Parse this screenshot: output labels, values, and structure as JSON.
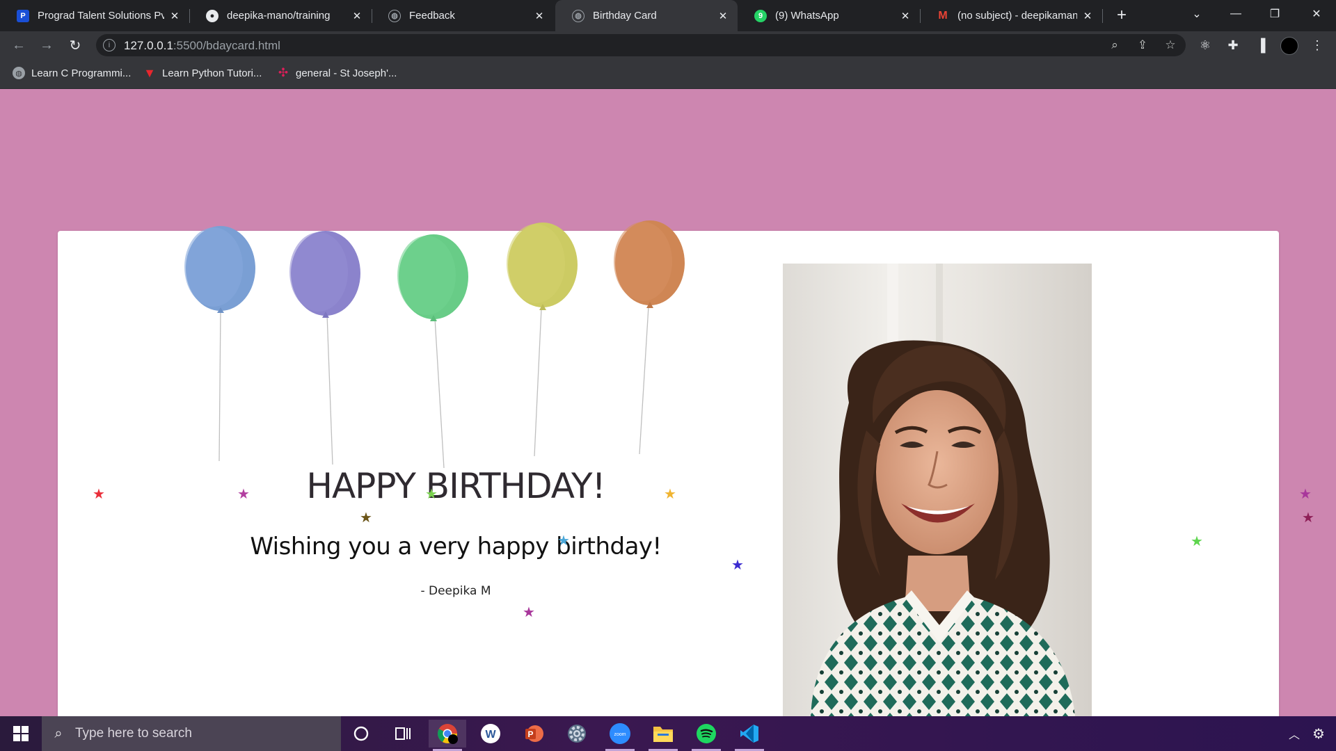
{
  "browser": {
    "tabs": [
      {
        "title": "Prograd Talent Solutions Pv",
        "icon": "prograd-icon",
        "active": false
      },
      {
        "title": "deepika-mano/training",
        "icon": "github-icon",
        "active": false
      },
      {
        "title": "Feedback",
        "icon": "globe-icon",
        "active": false
      },
      {
        "title": "Birthday Card",
        "icon": "globe-icon",
        "active": true
      },
      {
        "title": "(9) WhatsApp",
        "icon": "whatsapp-icon",
        "active": false
      },
      {
        "title": "(no subject) - deepikamanc",
        "icon": "gmail-icon",
        "active": false
      }
    ],
    "address": {
      "host": "127.0.0.1",
      "path": ":5500/bdaycard.html"
    },
    "bookmarks": [
      {
        "label": "Learn C Programmi...",
        "icon": "globe-icon"
      },
      {
        "label": "Learn Python Tutori...",
        "icon": "bookmark-v-icon"
      },
      {
        "label": "general - St Joseph'...",
        "icon": "slack-icon"
      }
    ]
  },
  "page": {
    "headline": "HAPPY BIRTHDAY!",
    "wish": "Wishing you a very happy birthday!",
    "signature": "- Deepika M",
    "background_color": "#cd86b0",
    "balloon_colors": [
      "#7a9fd4",
      "#8b83cc",
      "#68cc87",
      "#cccb63",
      "#cf8654"
    ],
    "star_colors": [
      "#ea2e3a",
      "#b23fa0",
      "#6b5518",
      "#7ad14f",
      "#f0b431",
      "#4aa7d8",
      "#3b2bd0",
      "#a8379b",
      "#8e1f57",
      "#5ed54e"
    ]
  },
  "taskbar": {
    "search_placeholder": "Type here to search",
    "apps": [
      "cortana-icon",
      "task-view-icon",
      "chrome-icon",
      "word-icon",
      "powerpoint-icon",
      "settings-icon",
      "zoom-icon",
      "file-explorer-icon",
      "spotify-icon",
      "vscode-icon"
    ]
  }
}
